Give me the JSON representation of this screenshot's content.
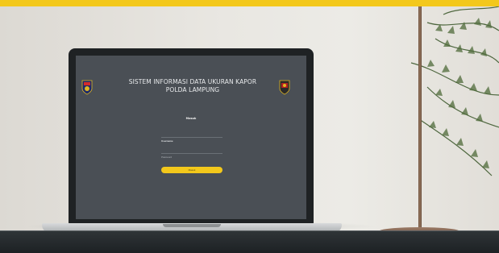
{
  "app": {
    "title_line1": "SISTEM INFORMASI DATA UKURAN KAPOR",
    "title_line2": "POLDA LAMPUNG"
  },
  "login": {
    "heading": "Masuk",
    "username_placeholder": "Username",
    "password_placeholder": "Password",
    "submit_label": "Masuk"
  },
  "colors": {
    "accent": "#f3c81b",
    "screen_bg": "#4a4f55"
  },
  "icons": [
    "polda-logo-icon",
    "polri-emblem-icon"
  ]
}
